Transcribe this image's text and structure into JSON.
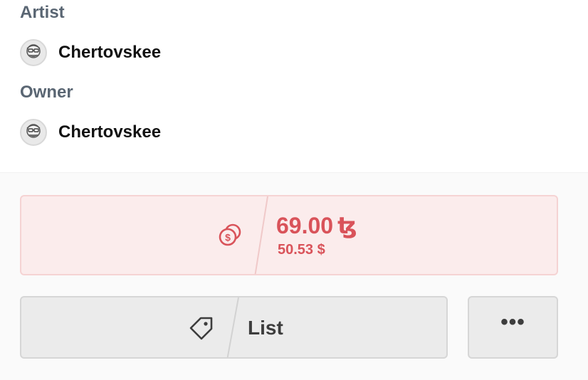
{
  "artist": {
    "label": "Artist",
    "name": "Chertovskee",
    "avatar_icon": "avatar-icon"
  },
  "owner": {
    "label": "Owner",
    "name": "Chertovskee",
    "avatar_icon": "avatar-icon"
  },
  "price": {
    "amount": "69.00",
    "currency_symbol": "ꜩ",
    "usd": "50.53 $",
    "icon": "coins-icon",
    "accent_color": "#d9535a",
    "background_color": "#fbecec"
  },
  "actions": {
    "list_label": "List",
    "list_icon": "tag-icon",
    "more_label": "•••"
  }
}
